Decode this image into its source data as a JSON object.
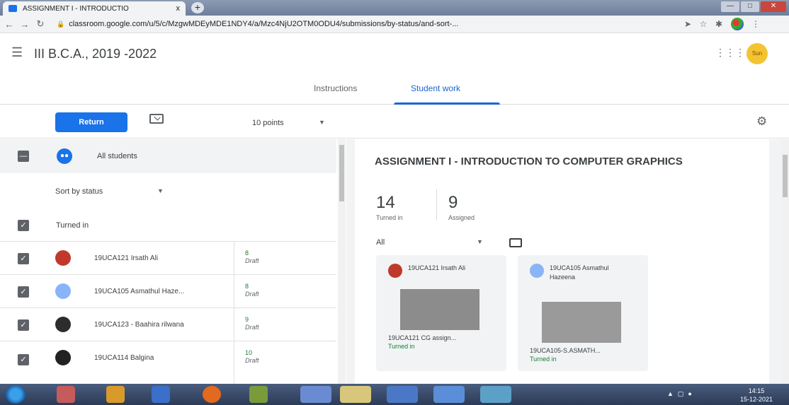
{
  "browser": {
    "tab_title": "ASSIGNMENT I - INTRODUCTIO",
    "tab_close": "x",
    "new_tab": "+",
    "url": "classroom.google.com/u/5/c/MzgwMDEyMDE1NDY4/a/Mzc4NjU2OTM0ODU4/submissions/by-status/and-sort-..."
  },
  "header": {
    "class_name": "III B.C.A., 2019 -2022",
    "avatar_text": "Sun"
  },
  "tabs": {
    "instructions": "Instructions",
    "student_work": "Student work"
  },
  "toolbar": {
    "return_label": "Return",
    "points": "10 points"
  },
  "left": {
    "all_students": "All students",
    "sort_label": "Sort by status",
    "section": "Turned in",
    "students": [
      {
        "name": "19UCA121 Irsath Ali",
        "grade": "8",
        "status": "Draft",
        "avatar_color": "#c0392b"
      },
      {
        "name": "19UCA105 Asmathul Haze...",
        "grade": "8",
        "status": "Draft",
        "avatar_color": "#8ab4f8"
      },
      {
        "name": "19UCA123 - Baahira rilwana",
        "grade": "9",
        "status": "Draft",
        "avatar_color": "#2d2d2d"
      },
      {
        "name": "19UCA114 Balgina",
        "grade": "10",
        "status": "Draft",
        "avatar_color": "#222222"
      }
    ]
  },
  "assignment": {
    "title": "ASSIGNMENT I - INTRODUCTION TO COMPUTER GRAPHICS",
    "turned_in_count": "14",
    "turned_in_label": "Turned in",
    "assigned_count": "9",
    "assigned_label": "Assigned",
    "filter": "All"
  },
  "submissions": [
    {
      "name": "19UCA121 Irsath Ali",
      "file": "19UCA121 CG assign...",
      "status": "Turned in",
      "avatar_color": "#c0392b"
    },
    {
      "name": "19UCA105 Asmathul Hazeena",
      "file": "19UCA105-S.ASMATH...",
      "status": "Turned in",
      "avatar_color": "#8ab4f8"
    }
  ],
  "taskbar": {
    "clock_time": "14:15",
    "clock_date": "15-12-2021"
  },
  "colors": {
    "accent": "#1a73e8",
    "grade_green": "#188038"
  }
}
